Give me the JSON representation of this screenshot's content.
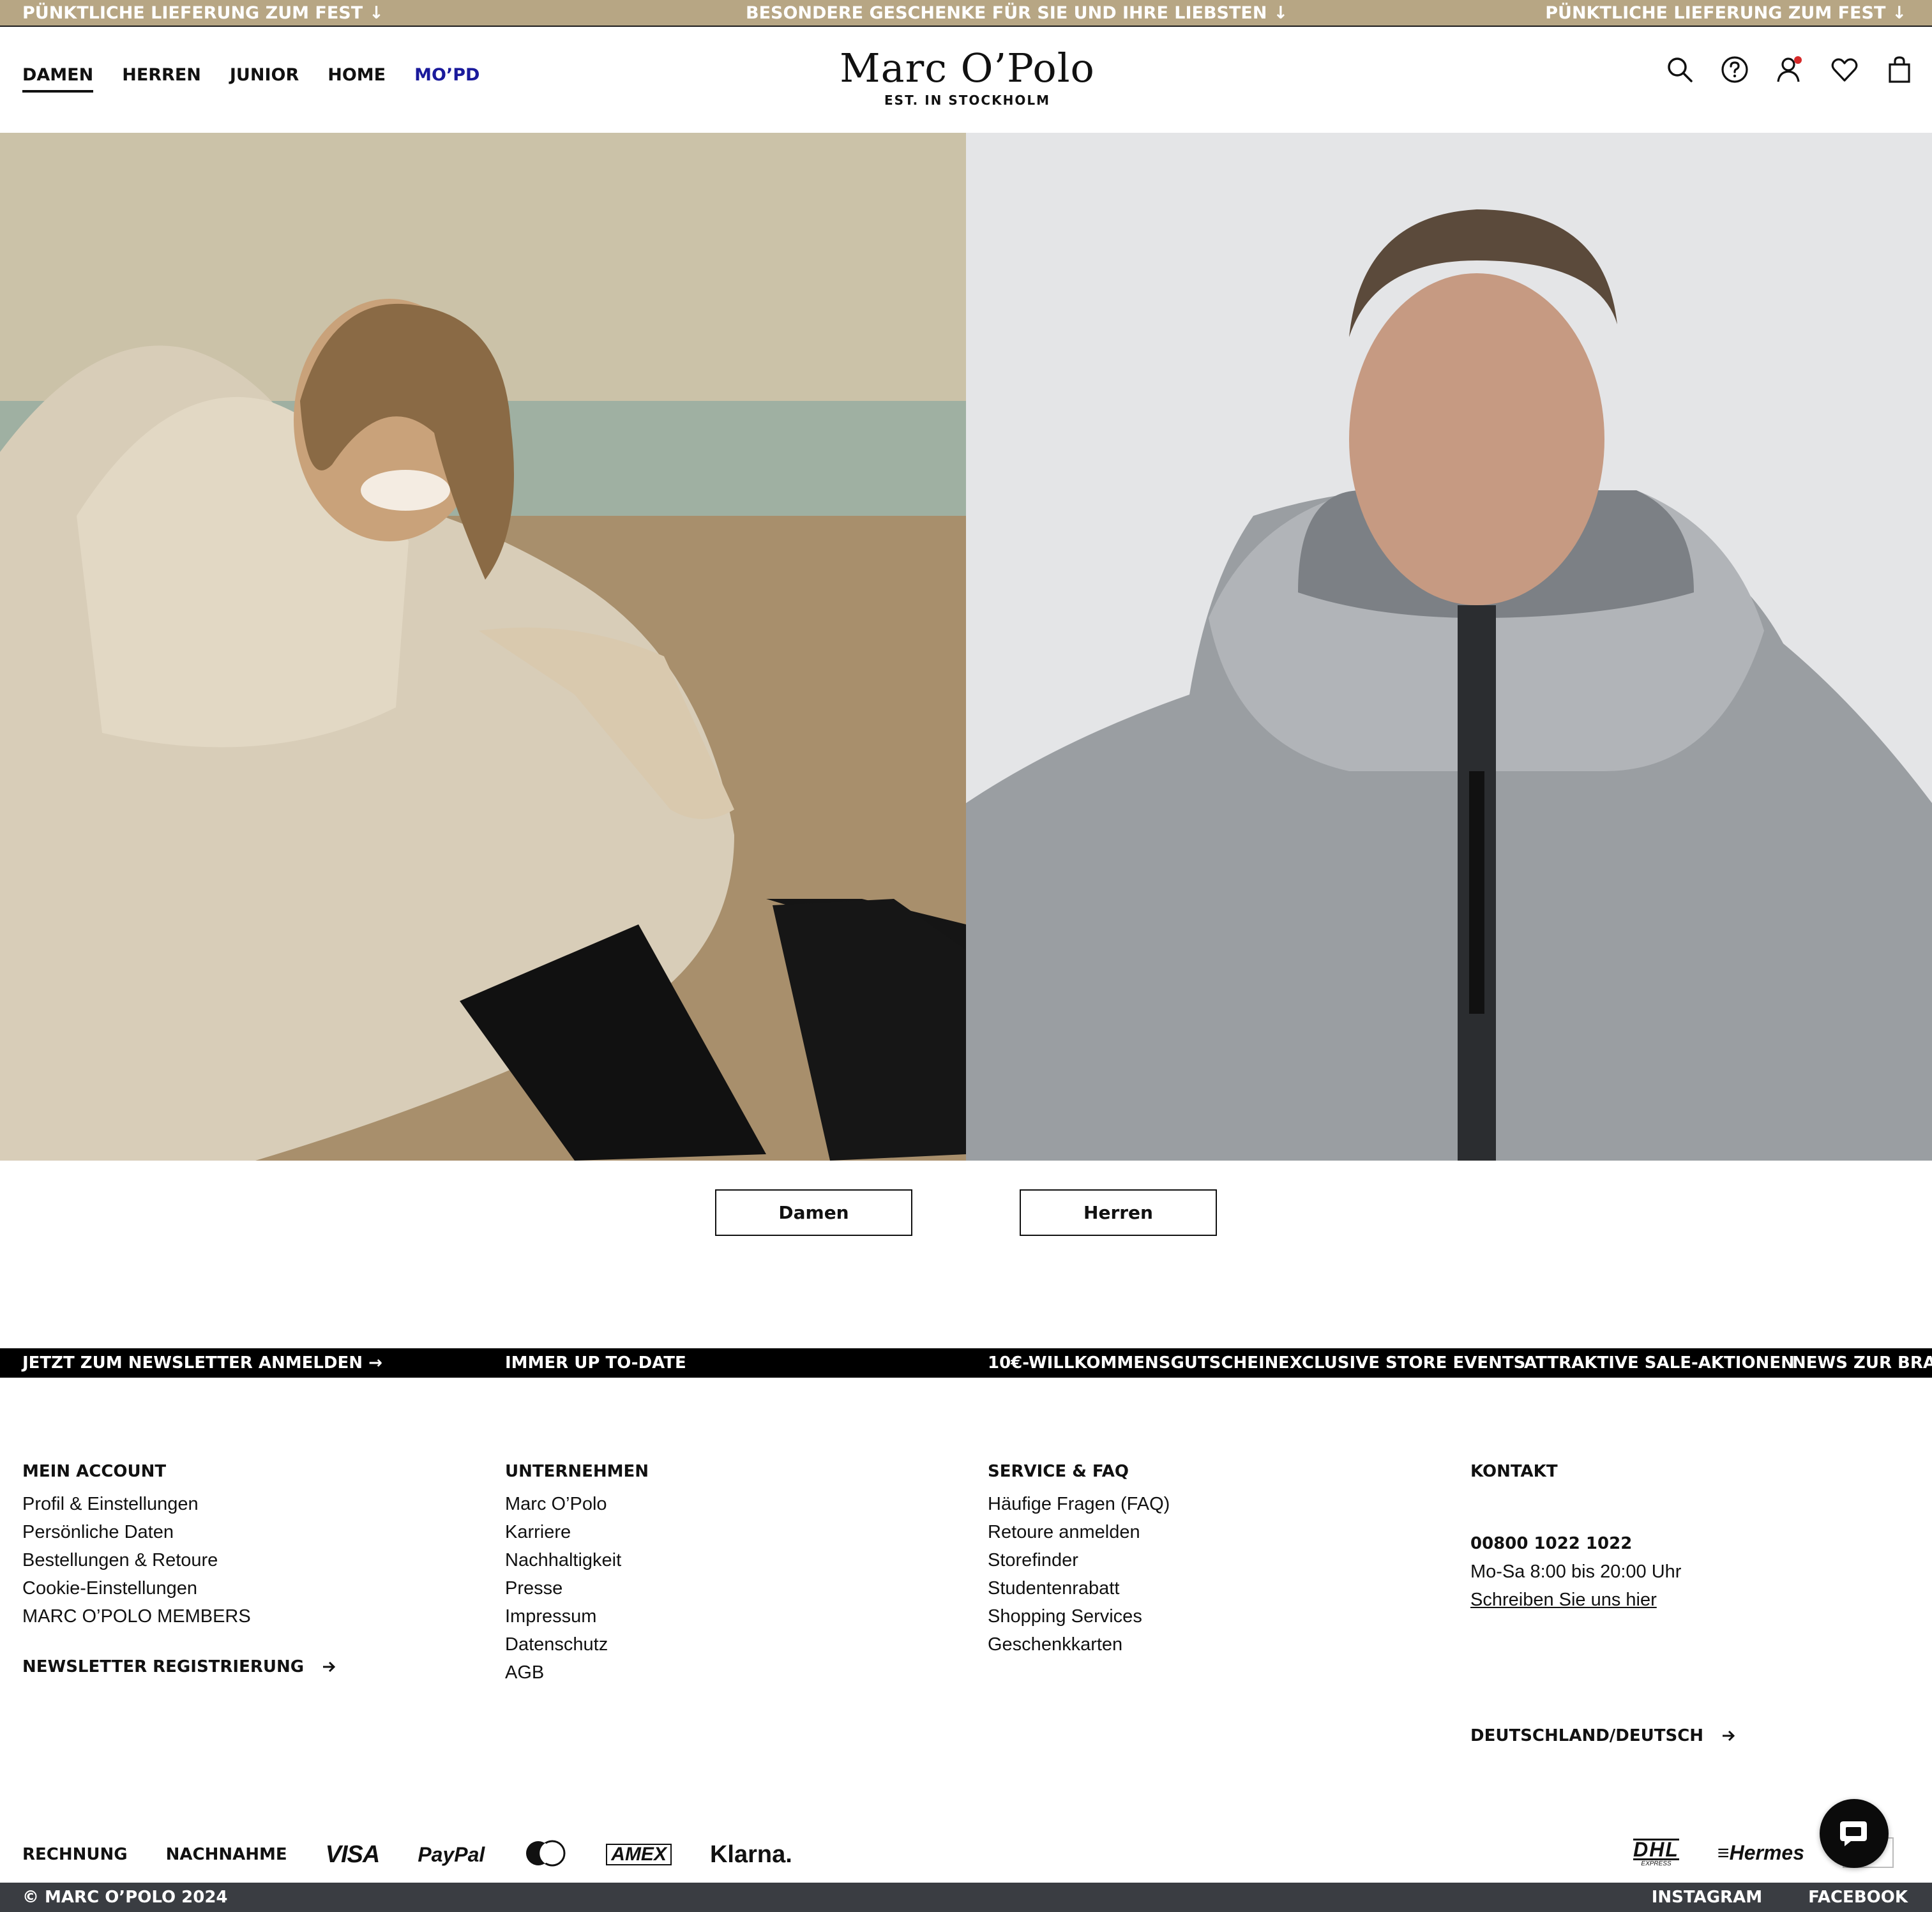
{
  "announcement": {
    "left": "PÜNKTLICHE LIEFERUNG ZUM FEST",
    "center": "BESONDERE GESCHENKE FÜR SIE UND IHRE LIEBSTEN",
    "right": "PÜNKTLICHE LIEFERUNG ZUM FEST",
    "arrow": "↓",
    "bg_color": "#b7a684"
  },
  "nav": {
    "items": [
      {
        "label": "DAMEN"
      },
      {
        "label": "HERREN"
      },
      {
        "label": "JUNIOR"
      },
      {
        "label": "HOME"
      },
      {
        "label": "MO’PD"
      }
    ],
    "active": "DAMEN",
    "mopd_color": "#1a1a9c"
  },
  "logo": {
    "brand": "Marc O’Polo",
    "tagline": "EST. IN STOCKHOLM"
  },
  "header_icons": [
    "search-icon",
    "help-icon",
    "account-icon",
    "wishlist-icon",
    "bag-icon"
  ],
  "hero": {
    "left_image": "woman-in-beige-puffer-jacket-on-beach",
    "right_image": "man-in-grey-hooded-puffer-jacket"
  },
  "buttons": {
    "women": "Damen",
    "men": "Herren"
  },
  "ticker": {
    "items": [
      "JETZT ZUM NEWSLETTER ANMELDEN →",
      "IMMER UP TO-DATE",
      "10€-WILLKOMMENSGUTSCHEIN",
      "EXCLUSIVE STORE EVENTS",
      "ATTRAKTIVE SALE-AKTIONEN",
      "NEWS ZUR BRA"
    ]
  },
  "footer": {
    "account": {
      "title": "MEIN ACCOUNT",
      "links": [
        "Profil & Einstellungen",
        "Persönliche Daten",
        "Bestellungen & Retoure",
        "Cookie-Einstellungen",
        "MARC O’POLO MEMBERS"
      ],
      "newsletter": "NEWSLETTER REGISTRIERUNG"
    },
    "company": {
      "title": "UNTERNEHMEN",
      "links": [
        "Marc O’Polo",
        "Karriere",
        "Nachhaltigkeit",
        "Presse",
        "Impressum",
        "Datenschutz",
        "AGB"
      ]
    },
    "service": {
      "title": "SERVICE & FAQ",
      "links": [
        "Häufige Fragen (FAQ)",
        "Retoure anmelden",
        "Storefinder",
        "Studentenrabatt",
        "Shopping Services",
        "Geschenkkarten"
      ]
    },
    "contact": {
      "title": "KONTAKT",
      "phone": "00800 1022 1022",
      "hours": "Mo-Sa 8:00 bis 20:00 Uhr",
      "write": "Schreiben Sie uns hier",
      "country": "DEUTSCHLAND/DEUTSCH"
    }
  },
  "payments": {
    "invoice": "RECHNUNG",
    "cod": "NACHNAHME",
    "visa": "VISA",
    "paypal": "PayPal",
    "mastercard": "mastercard-icon",
    "amex": "AMEX",
    "klarna": "Klarna."
  },
  "shipping": {
    "dhl": "DHL",
    "dhl_sub": "EXPRESS",
    "hermes": "Hermes"
  },
  "bottom": {
    "copyright": "© MARC O’POLO 2024",
    "instagram": "INSTAGRAM",
    "facebook": "FACEBOOK"
  }
}
